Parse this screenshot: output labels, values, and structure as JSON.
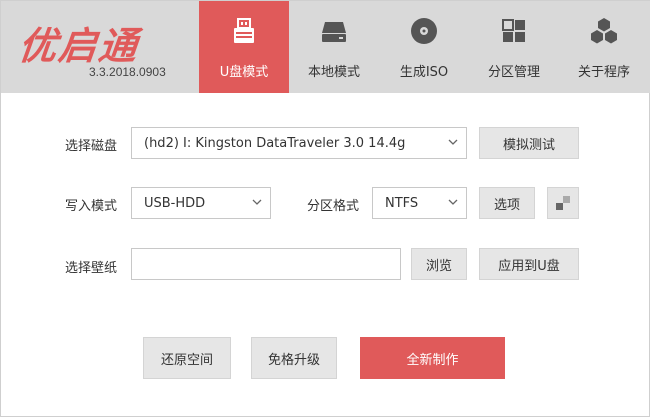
{
  "app": {
    "brand": "优启通",
    "version": "3.3.2018.0903"
  },
  "tabs": [
    {
      "label": "U盘模式",
      "icon": "usb-drive-icon",
      "active": true
    },
    {
      "label": "本地模式",
      "icon": "hard-drive-icon",
      "active": false
    },
    {
      "label": "生成ISO",
      "icon": "disc-icon",
      "active": false
    },
    {
      "label": "分区管理",
      "icon": "partition-grid-icon",
      "active": false
    },
    {
      "label": "关于程序",
      "icon": "cubes-icon",
      "active": false
    }
  ],
  "form": {
    "disk_label": "选择磁盘",
    "disk_value": "(hd2) I: Kingston DataTraveler 3.0 14.4g",
    "simulate_test": "模拟测试",
    "write_mode_label": "写入模式",
    "write_mode_value": "USB-HDD",
    "partition_format_label": "分区格式",
    "partition_format_value": "NTFS",
    "options": "选项",
    "wallpaper_label": "选择壁纸",
    "wallpaper_value": "",
    "browse": "浏览",
    "apply_to_usb": "应用到U盘"
  },
  "actions": {
    "restore_space": "还原空间",
    "upgrade_no_format": "免格升级",
    "new_create": "全新制作"
  },
  "colors": {
    "accent": "#e05a5a",
    "header_bg": "#d9d9d9",
    "button_bg": "#e6e6e6"
  }
}
